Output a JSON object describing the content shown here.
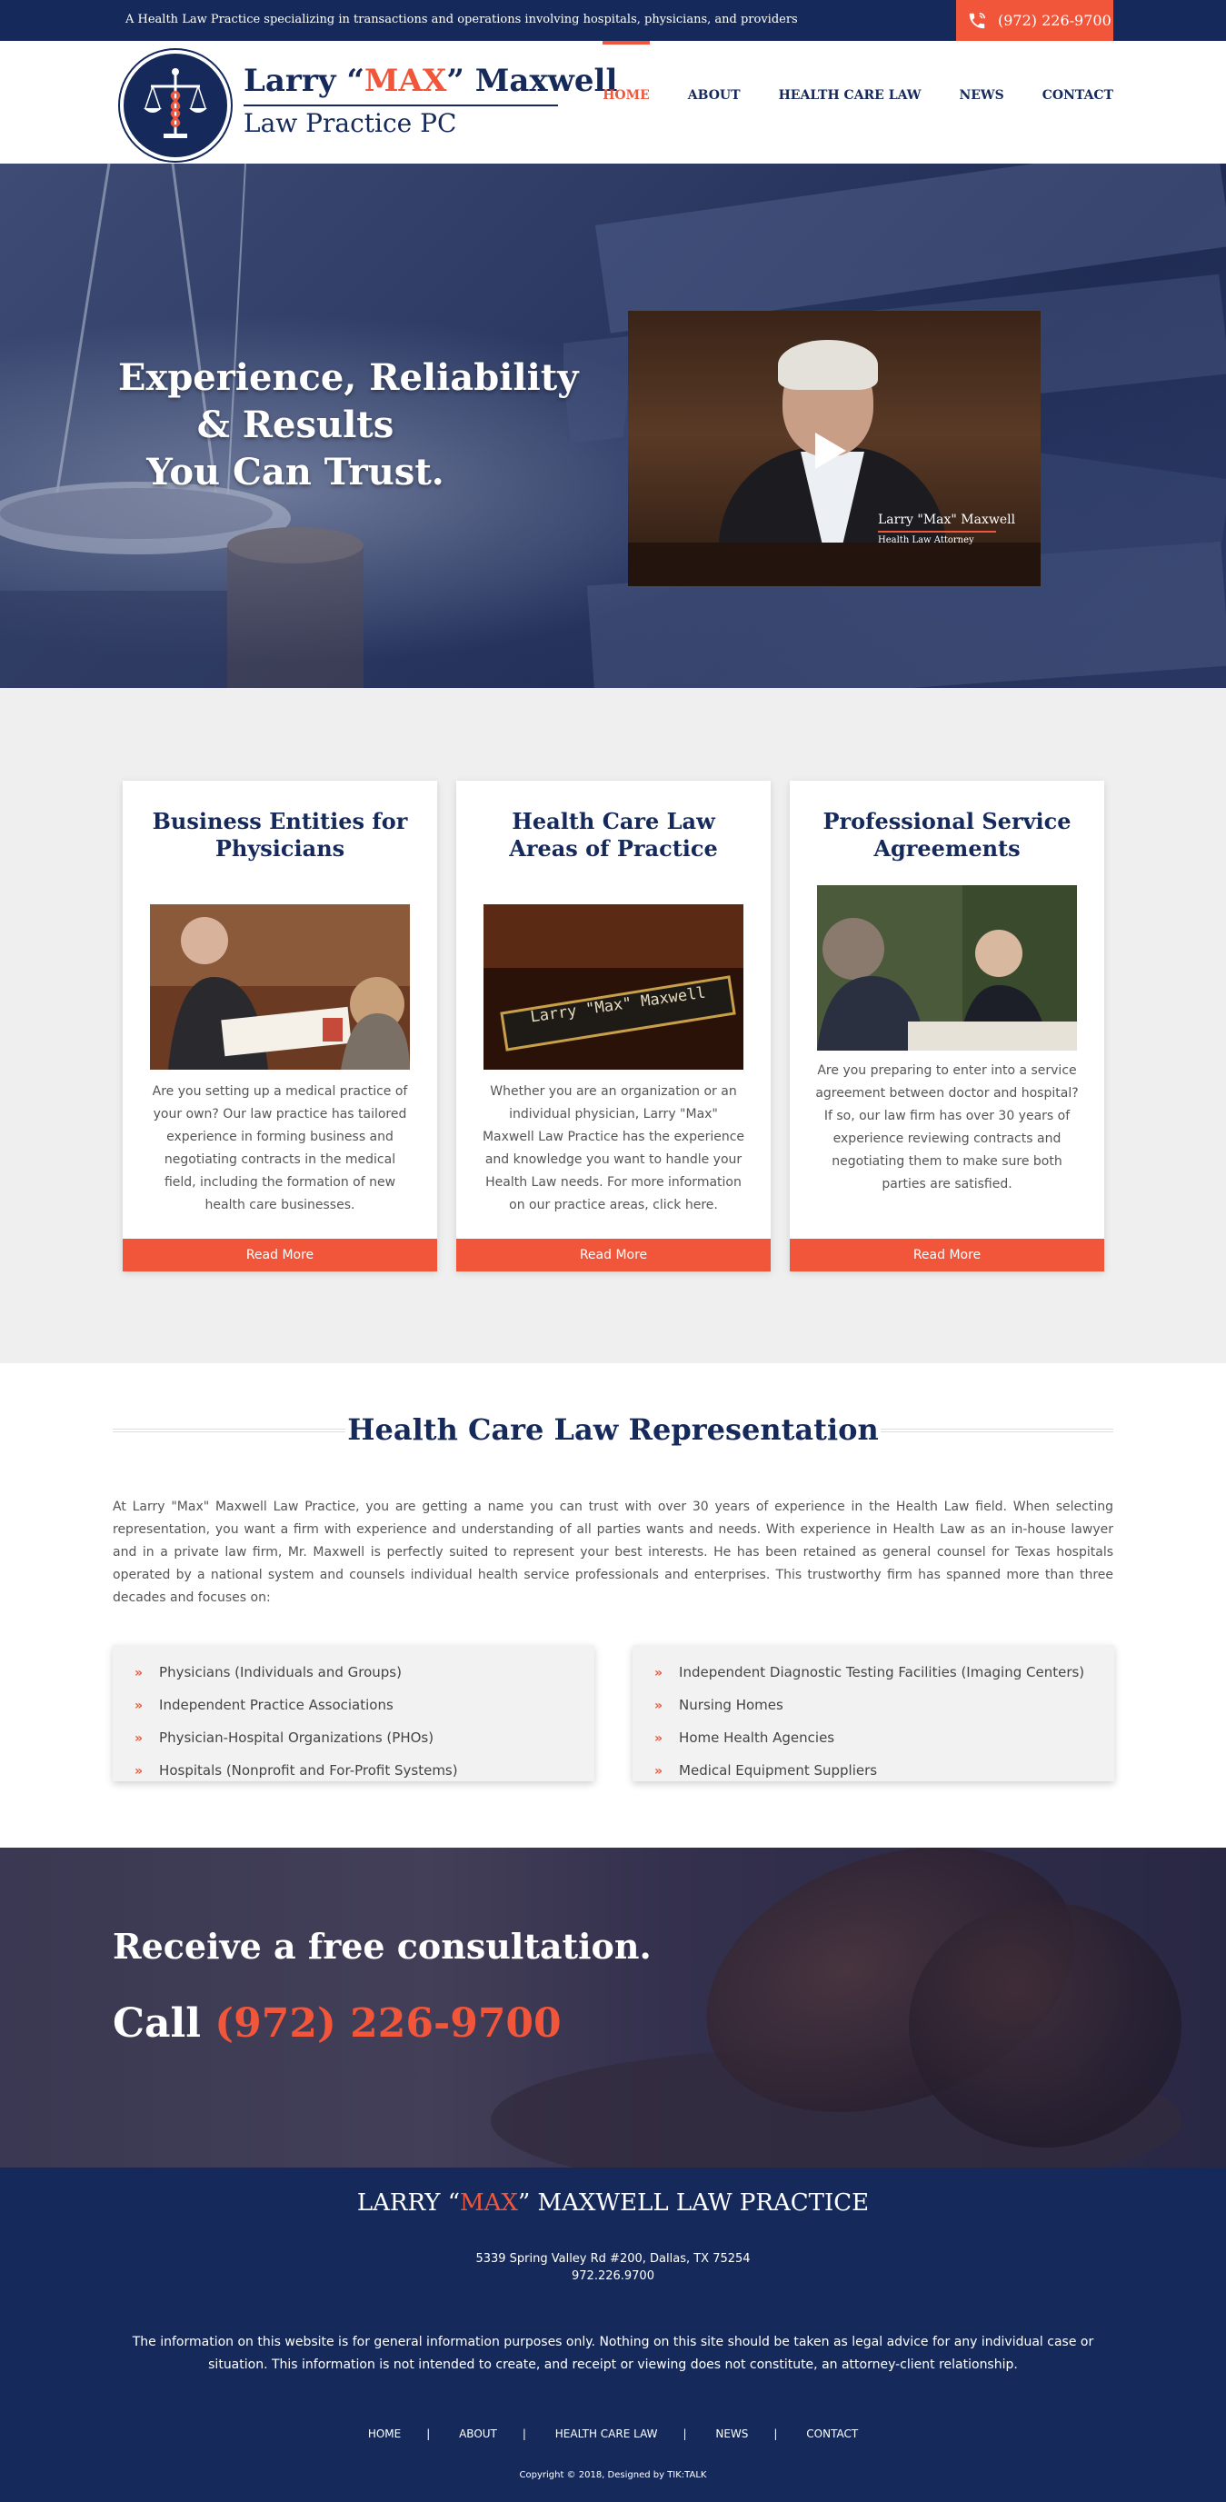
{
  "topbar": {
    "tagline": "A Health Law Practice specializing in transactions and operations involving hospitals, physicians, and providers",
    "phone": "(972) 226-9700"
  },
  "header": {
    "logo_name_pre": "Larry “",
    "logo_name_max": "MAX",
    "logo_name_post": "” Maxwell",
    "logo_sub": "Law Practice PC",
    "nav": [
      {
        "label": "HOME",
        "active": true
      },
      {
        "label": "ABOUT"
      },
      {
        "label": "HEALTH CARE LAW"
      },
      {
        "label": "NEWS"
      },
      {
        "label": "CONTACT"
      }
    ]
  },
  "hero": {
    "headline_line1": "Experience, Reliability",
    "headline_line2": "& Results",
    "headline_line3": "You Can Trust.",
    "video_caption_name": "Larry \"Max\" Maxwell",
    "video_caption_title": "Health Law Attorney"
  },
  "services": {
    "cards": [
      {
        "title": "Business Entities for Physicians",
        "text": "Are you setting up a medical practice of your own? Our law practice has tailored experience in forming business and negotiating contracts in the medical field, including the formation of new health care businesses.",
        "button": "Read More"
      },
      {
        "title": "Health Care Law Areas of Practice",
        "nameplate": "Larry \"Max\" Maxwell",
        "text": "Whether you are an organization or an individual physician, Larry \"Max\" Maxwell Law Practice has the experience and knowledge you want to handle your Health Law needs. For more information on our practice areas, click here.",
        "button": "Read More"
      },
      {
        "title": "Professional Service Agreements",
        "text": "Are you preparing to enter into a service agreement between doctor and hospital? If so, our law firm has over 30 years of experience reviewing contracts and negotiating them to make sure both parties are satisfied.",
        "button": "Read More"
      }
    ]
  },
  "representation": {
    "title": "Health Care Law Representation",
    "text": "At Larry \"Max\" Maxwell Law Practice, you are getting a name you can trust with over 30 years of experience in the Health Law field. When selecting representation, you want a firm with experience and understanding of all parties wants and needs. With experience in Health Law as an in-house lawyer and in a private law firm, Mr. Maxwell is perfectly suited to represent your best interests. He has been retained as general counsel for Texas hospitals operated by a national system and counsels individual health service professionals and enterprises. This trustworthy firm has spanned more than three decades and focuses on:",
    "list_left": [
      "Physicians (Individuals and Groups)",
      "Independent Practice Associations",
      "Physician-Hospital Organizations (PHOs)",
      "Hospitals (Nonprofit and For-Profit Systems)"
    ],
    "list_right": [
      "Independent Diagnostic Testing Facilities (Imaging Centers)",
      "Nursing Homes",
      "Home Health Agencies",
      "Medical Equipment Suppliers"
    ]
  },
  "consult": {
    "heading": "Receive a free consultation.",
    "call_label": "Call",
    "call_number": "(972) 226-9700"
  },
  "footer": {
    "name_pre": "LARRY “",
    "name_max": "MAX",
    "name_post": "” MAXWELL LAW PRACTICE",
    "address": "5339 Spring Valley Rd #200, Dallas, TX 75254",
    "phone": "972.226.9700",
    "disclaimer": "The information on this website is for general information purposes only. Nothing on this site should be taken as legal advice for any individual case or situation. This information is not intended to create, and receipt or viewing does not constitute, an attorney-client relationship.",
    "nav": [
      "HOME",
      "ABOUT",
      "HEALTH CARE LAW",
      "NEWS",
      "CONTACT"
    ],
    "copyright": "Copyright © 2018,  Designed by TIK:TALK"
  },
  "colors": {
    "navy": "#152a5b",
    "accent": "#f1563b",
    "section_gray": "#efefef"
  },
  "icons": [
    "phone-icon",
    "play-icon",
    "chevron-right-icon",
    "scales-caduceus-logo"
  ]
}
